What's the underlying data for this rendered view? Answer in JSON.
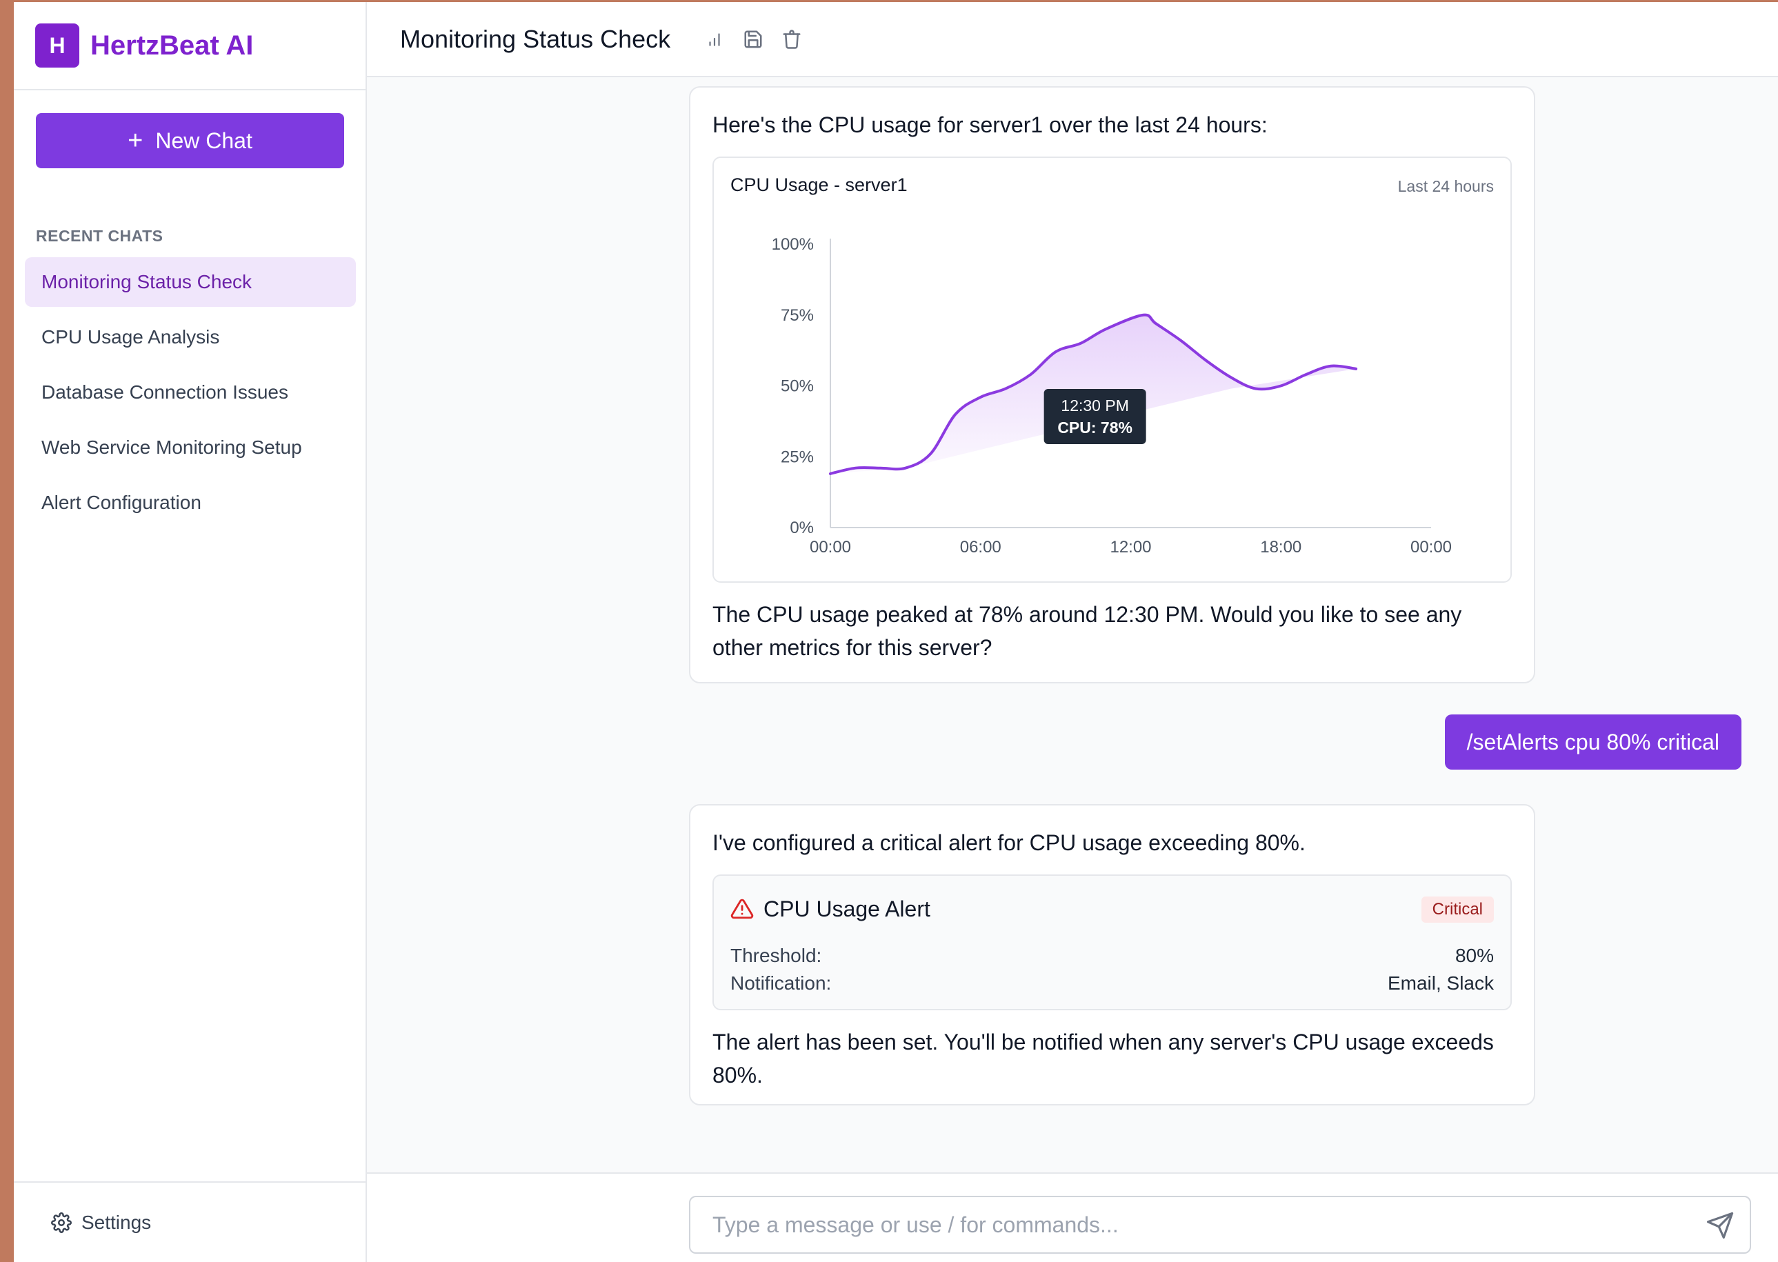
{
  "brand": {
    "logo_letter": "H",
    "name": "HertzBeat AI"
  },
  "sidebar": {
    "new_chat_label": "New Chat",
    "recent_heading": "RECENT CHATS",
    "items": [
      {
        "label": "Monitoring Status Check"
      },
      {
        "label": "CPU Usage Analysis"
      },
      {
        "label": "Database Connection Issues"
      },
      {
        "label": "Web Service Monitoring Setup"
      },
      {
        "label": "Alert Configuration"
      }
    ],
    "settings_label": "Settings"
  },
  "header": {
    "title": "Monitoring Status Check"
  },
  "messages": {
    "assistant1": {
      "intro": "Here's the CPU usage for server1 over the last 24 hours:",
      "outro": "The CPU usage peaked at 78% around 12:30 PM. Would you like to see any other metrics for this server?"
    },
    "user1": {
      "text": "/setAlerts cpu 80% critical"
    },
    "assistant2": {
      "intro": "I've configured a critical alert for CPU usage exceeding 80%.",
      "alert": {
        "title": "CPU Usage Alert",
        "severity": "Critical",
        "threshold_label": "Threshold:",
        "threshold_value": "80%",
        "notification_label": "Notification:",
        "notification_value": "Email, Slack"
      },
      "outro": "The alert has been set. You'll be notified when any server's CPU usage exceeds 80%."
    }
  },
  "composer": {
    "placeholder": "Type a message or use / for commands..."
  },
  "colors": {
    "accent": "#7e3ae0",
    "brand": "#7e22ce",
    "critical": "#dc2626"
  },
  "chart_data": {
    "type": "line",
    "title": "CPU Usage - server1",
    "subtitle": "Last 24 hours",
    "x_ticks": [
      "00:00",
      "06:00",
      "12:00",
      "18:00",
      "00:00"
    ],
    "y_ticks": [
      "0%",
      "25%",
      "50%",
      "75%",
      "100%"
    ],
    "ylim": [
      0,
      100
    ],
    "xlim_hours": [
      0,
      24
    ],
    "series": [
      {
        "x": [
          0,
          1,
          2,
          3,
          4,
          5,
          6,
          7,
          8,
          9,
          10,
          11,
          12.5,
          13,
          14,
          15,
          16,
          17,
          18,
          19,
          20,
          21
        ],
        "y": [
          19,
          21,
          21,
          21,
          26,
          40,
          46,
          49,
          54,
          62,
          65,
          70,
          75,
          72,
          66,
          59,
          53,
          49,
          50,
          54,
          57,
          56
        ]
      }
    ],
    "tooltip": {
      "time": "12:30 PM",
      "value": "CPU: 78%"
    }
  }
}
